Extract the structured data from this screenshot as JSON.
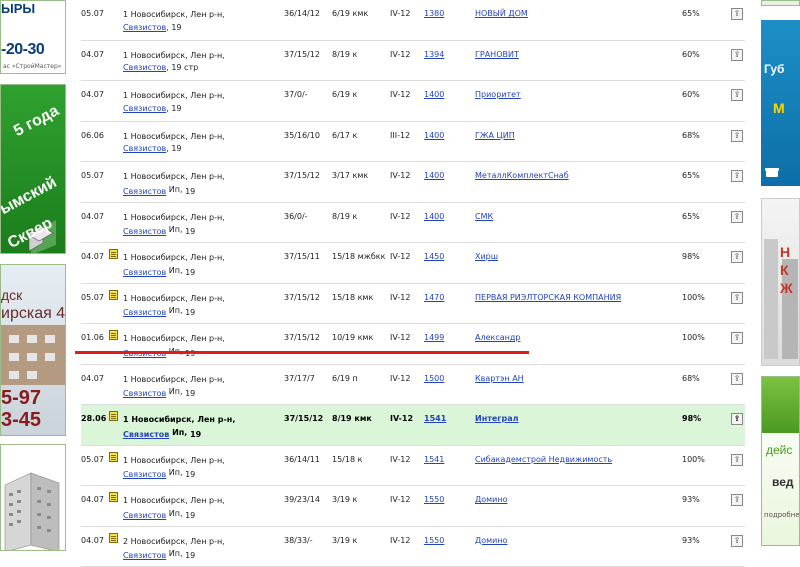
{
  "left_banners": {
    "b1": {
      "line1": "ЫРЫ",
      "phone": "-20-30",
      "small": "ас «СтройМастер»"
    },
    "b2": {
      "lines": [
        "5 года",
        "ымский",
        "Сквер"
      ]
    },
    "b3": {
      "line1": "дск",
      "line2": "ирская 4",
      "phone1": "5-97",
      "phone2": "3-45"
    },
    "b4": {}
  },
  "right_banners": {
    "r1": {
      "line1": "Губ",
      "line2": "М"
    },
    "r2": {
      "text": "Н\nК\nЖ"
    },
    "r3": {
      "line1": "дейс",
      "line2": "вед",
      "line3": "подробне"
    }
  },
  "rows": [
    {
      "date": "05.07",
      "doc": false,
      "addr1": "1 Новосибирск, Лен р-н,",
      "street": "Связистов",
      "num": ", 19",
      "ip": false,
      "flat": "36/14/12",
      "floor": "6/19 кмк",
      "type": "IV-12",
      "num_id": "1380",
      "agency": "НОВЫЙ ДОМ",
      "pct": "65%",
      "hl": false
    },
    {
      "date": "04.07",
      "doc": false,
      "addr1": "1 Новосибирск, Лен р-н,",
      "street": "Связистов",
      "num": ", 19 стр",
      "ip": false,
      "flat": "37/15/12",
      "floor": "8/19 к",
      "type": "IV-12",
      "num_id": "1394",
      "agency": "ГРАНОВИТ",
      "pct": "60%",
      "hl": false
    },
    {
      "date": "04.07",
      "doc": false,
      "addr1": "1 Новосибирск, Лен р-н,",
      "street": "Связистов",
      "num": ", 19",
      "ip": false,
      "flat": "37/0/-",
      "floor": "6/19 к",
      "type": "IV-12",
      "num_id": "1400",
      "agency": "Приоритет",
      "pct": "60%",
      "hl": false
    },
    {
      "date": "06.06",
      "doc": false,
      "addr1": "1 Новосибирск, Лен р-н,",
      "street": "Связистов",
      "num": ", 19",
      "ip": false,
      "flat": "35/16/10",
      "floor": "6/17 к",
      "type": "III-12",
      "num_id": "1400",
      "agency": "ГЖА ЦИП",
      "pct": "68%",
      "hl": false
    },
    {
      "date": "05.07",
      "doc": false,
      "addr1": "1 Новосибирск, Лен р-н,",
      "street": "Связистов",
      "num": " 19",
      "ip": true,
      "flat": "37/15/12",
      "floor": "3/17 кмк",
      "type": "IV-12",
      "num_id": "1400",
      "agency": "МеталлКомплектСнаб",
      "pct": "65%",
      "hl": false
    },
    {
      "date": "04.07",
      "doc": false,
      "addr1": "1 Новосибирск, Лен р-н,",
      "street": "Связистов",
      "num": " 19",
      "ip": true,
      "flat": "36/0/-",
      "floor": "8/19 к",
      "type": "IV-12",
      "num_id": "1400",
      "agency": "СМК",
      "pct": "65%",
      "hl": false
    },
    {
      "date": "04.07",
      "doc": true,
      "addr1": "1 Новосибирск, Лен р-н,",
      "street": "Связистов",
      "num": " 19",
      "ip": true,
      "flat": "37/15/11",
      "floor": "15/18 мжбкк",
      "type": "IV-12",
      "num_id": "1450",
      "agency": "Хирш",
      "pct": "98%",
      "hl": false
    },
    {
      "date": "05.07",
      "doc": true,
      "addr1": "1 Новосибирск, Лен р-н,",
      "street": "Связистов",
      "num": " 19",
      "ip": true,
      "flat": "37/15/12",
      "floor": "15/18 кмк",
      "type": "IV-12",
      "num_id": "1470",
      "agency": "ПЕРВАЯ РИЭЛТОРСКАЯ КОМПАНИЯ",
      "pct": "100%",
      "hl": false
    },
    {
      "date": "01.06",
      "doc": true,
      "addr1": "1 Новосибирск, Лен р-н,",
      "street": "Связистов",
      "num": " 19",
      "ip": true,
      "flat": "37/15/12",
      "floor": "10/19 кмк",
      "type": "IV-12",
      "num_id": "1499",
      "agency": "Александр",
      "pct": "100%",
      "hl": false
    },
    {
      "date": "04.07",
      "doc": false,
      "addr1": "1 Новосибирск, Лен р-н,",
      "street": "Связистов",
      "num": " 19",
      "ip": true,
      "flat": "37/17/7",
      "floor": "6/19 п",
      "type": "IV-12",
      "num_id": "1500",
      "agency": "Квартэн АН",
      "pct": "68%",
      "hl": false
    },
    {
      "date": "28.06",
      "doc": true,
      "addr1": "1 Новосибирск, Лен р-н,",
      "street": "Связистов",
      "num": " 19",
      "ip": true,
      "flat": "37/15/12",
      "floor": "8/19 кмк",
      "type": "IV-12",
      "num_id": "1541",
      "agency": "Интеграл",
      "pct": "98%",
      "hl": true
    },
    {
      "date": "05.07",
      "doc": true,
      "addr1": "1 Новосибирск, Лен р-н,",
      "street": "Связистов",
      "num": " 19",
      "ip": true,
      "flat": "36/14/11",
      "floor": "15/18 к",
      "type": "IV-12",
      "num_id": "1541",
      "agency": "Сибакадемстрой Недвижимость",
      "pct": "100%",
      "hl": false
    },
    {
      "date": "04.07",
      "doc": true,
      "addr1": "1 Новосибирск, Лен р-н,",
      "street": "Связистов",
      "num": " 19",
      "ip": true,
      "flat": "39/23/14",
      "floor": "3/19 к",
      "type": "IV-12",
      "num_id": "1550",
      "agency": "Домино",
      "pct": "93%",
      "hl": false
    },
    {
      "date": "04.07",
      "doc": true,
      "addr1": "2 Новосибирск, Лен р-н,",
      "street": "Связистов",
      "num": " 19",
      "ip": true,
      "flat": "38/33/-",
      "floor": "3/19 к",
      "type": "IV-12",
      "num_id": "1550",
      "agency": "Домино",
      "pct": "93%",
      "hl": false
    }
  ],
  "ip_label": "Ип,",
  "row_button_glyph": "⇪"
}
